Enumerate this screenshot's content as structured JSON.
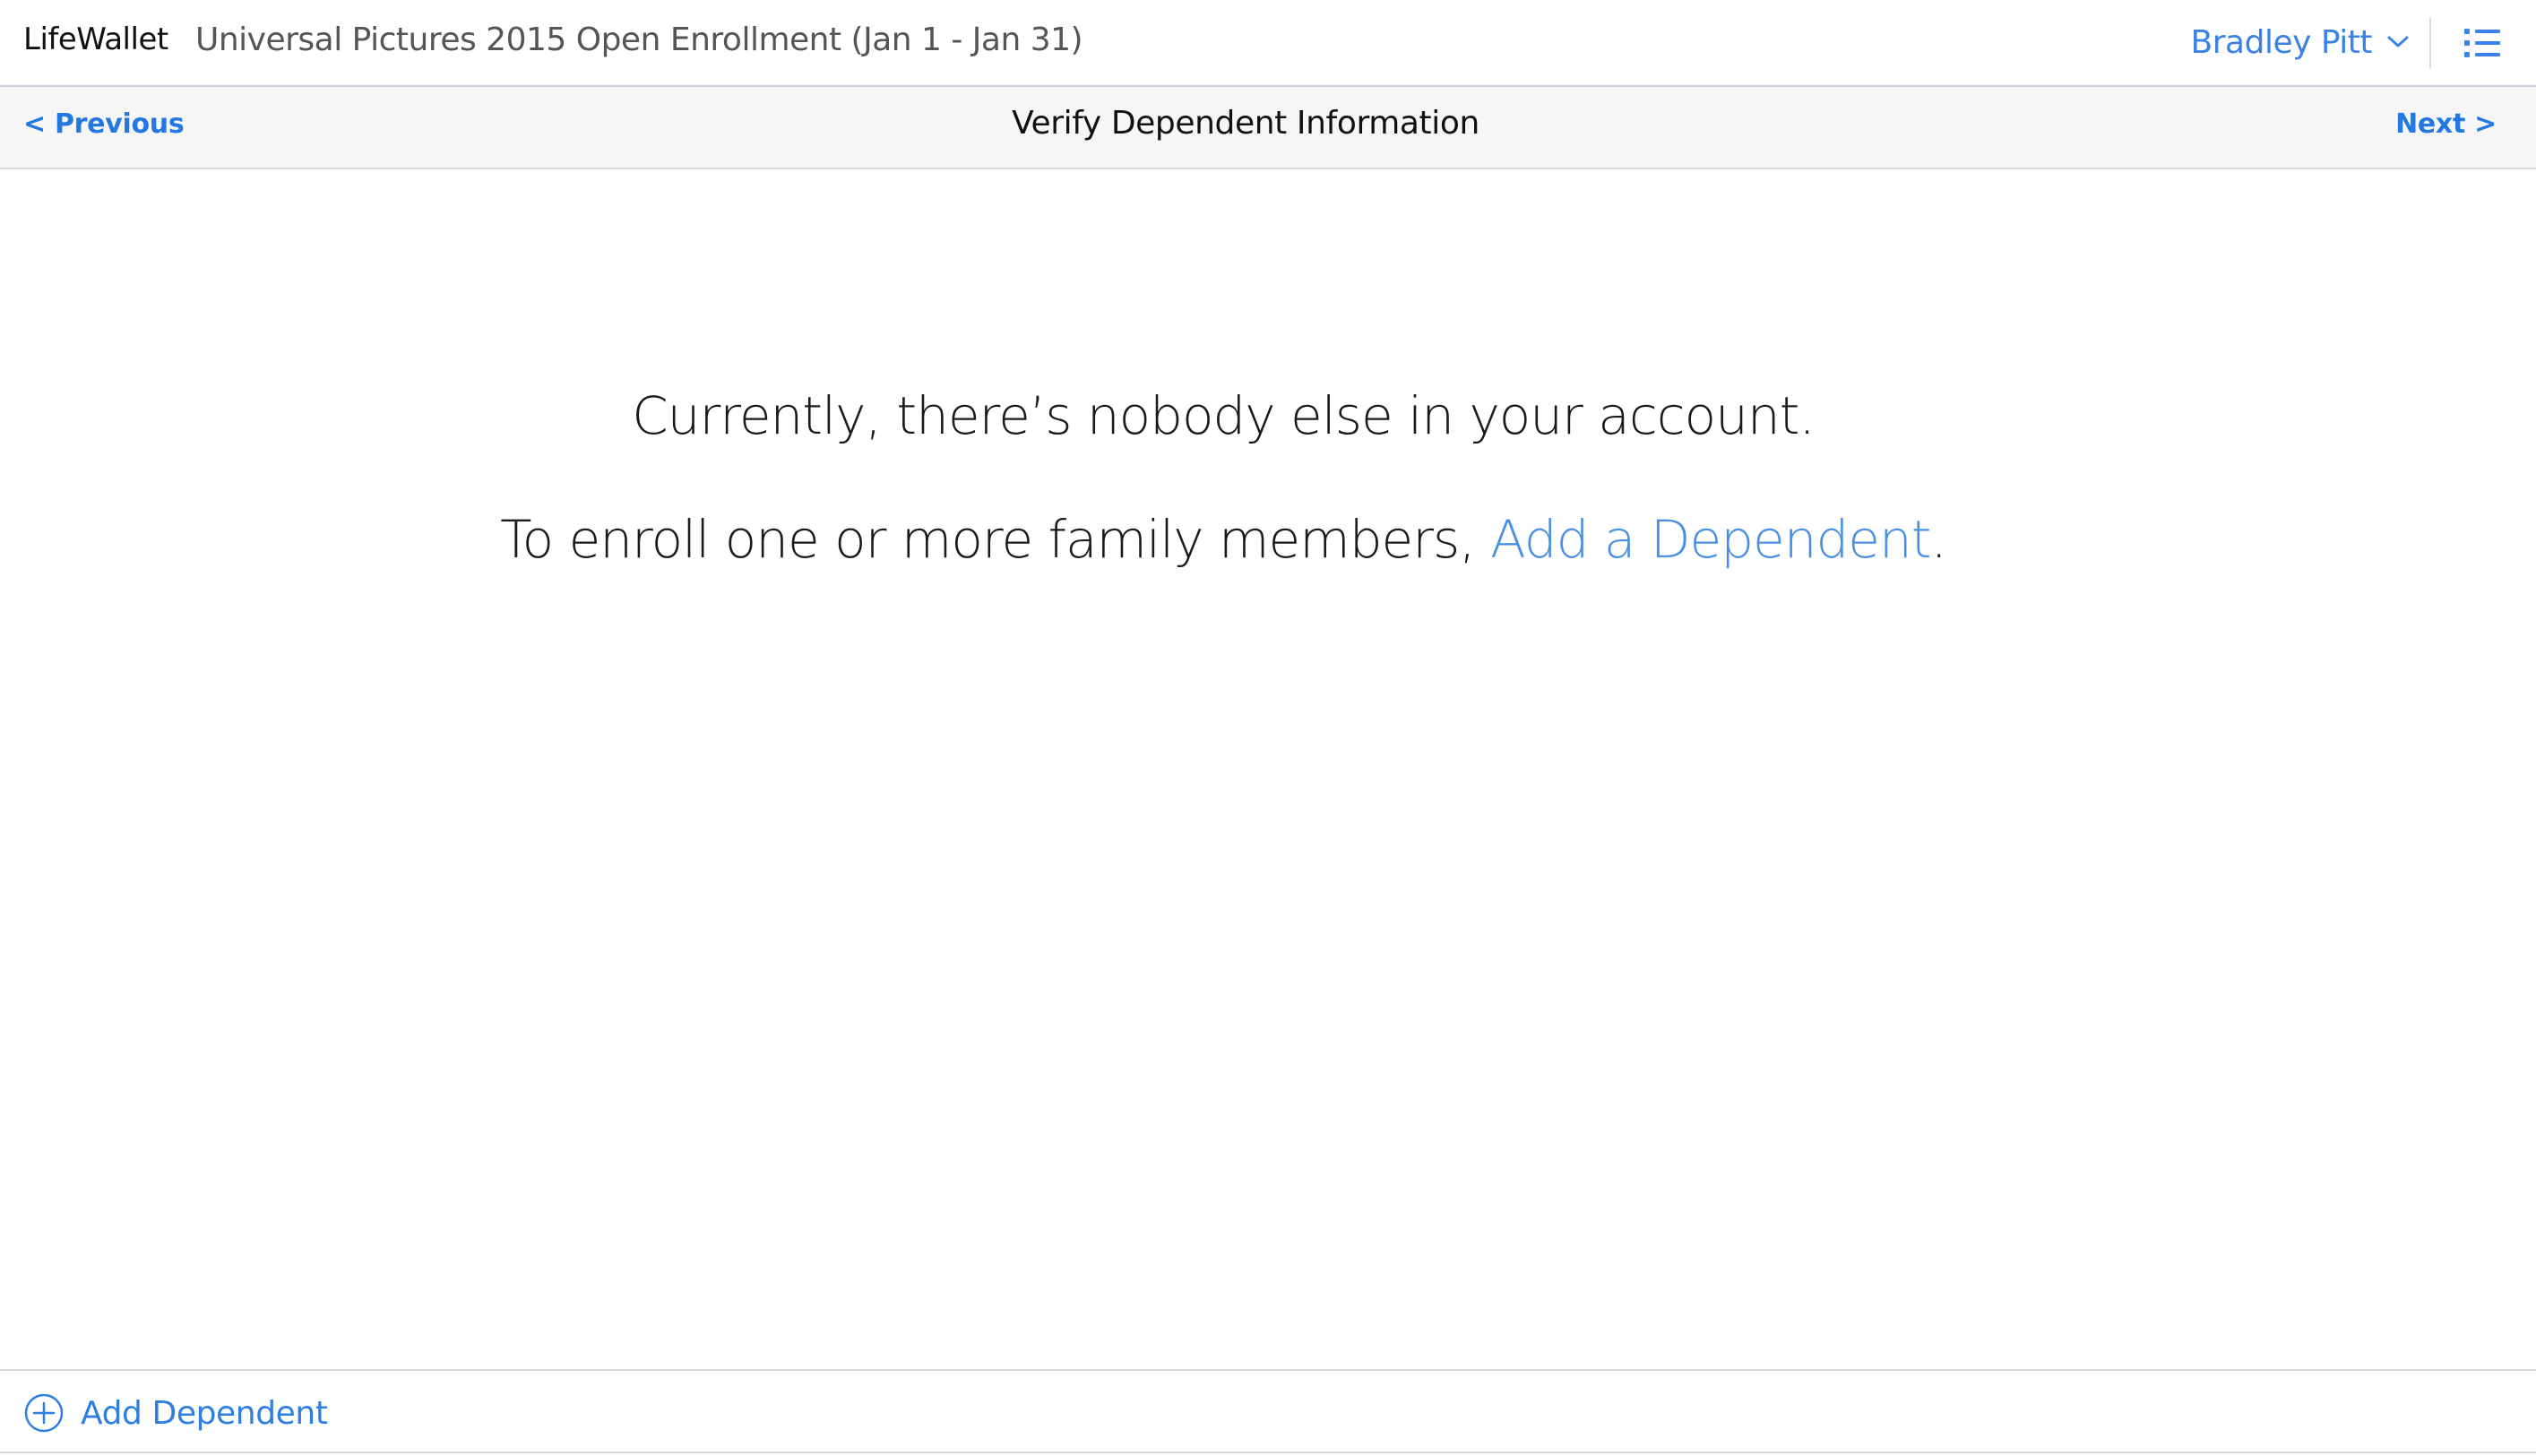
{
  "header": {
    "brand": "LifeWallet",
    "enrollment_title": "Universal Pictures 2015 Open Enrollment (Jan 1 - Jan 31)",
    "user_name": "Bradley Pitt",
    "user_menu_icon": "chevron-down-icon",
    "menu_icon": "list-menu-icon"
  },
  "step_nav": {
    "previous_label": "< Previous",
    "title": "Verify Dependent Information",
    "next_label": "Next >"
  },
  "empty_state": {
    "line1": "Currently, there’s nobody else in your account.",
    "line2_prefix": "To enroll one or more family members, ",
    "line2_link": "Add a Dependent",
    "line2_suffix": "."
  },
  "footer": {
    "add_dependent_label": "Add Dependent",
    "add_dependent_icon": "plus-circle-icon"
  },
  "colors": {
    "accent": "#2f7fe0",
    "link_light": "#4a90e2",
    "nav_bar_bg": "#f6f6f6",
    "header_border": "#c9d3e0",
    "divider": "#d8d8d8"
  }
}
